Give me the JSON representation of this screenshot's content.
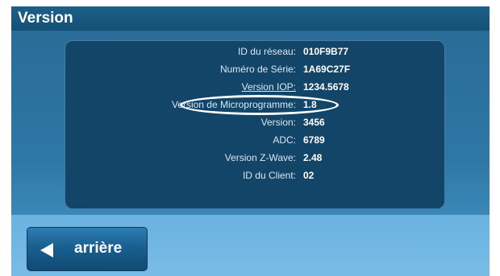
{
  "header": {
    "title": "Version"
  },
  "info": {
    "rows": [
      {
        "label": "ID du réseau:",
        "value": "010F9B77"
      },
      {
        "label": "Numéro de Série:",
        "value": "1A69C27F"
      },
      {
        "label": "Version IOP:",
        "value": "1234.5678"
      },
      {
        "label": "Version de Microprogramme:",
        "value": "1.8"
      },
      {
        "label": "Version:",
        "value": "3456"
      },
      {
        "label": "ADC:",
        "value": "6789"
      },
      {
        "label": "Version Z-Wave:",
        "value": "2.48"
      },
      {
        "label": "ID du Client:",
        "value": "02"
      }
    ]
  },
  "footer": {
    "back_label": "arrière",
    "back_icon": "triangle-left-icon"
  },
  "colors": {
    "title_bar": "#145176",
    "panel": "#134568",
    "footer": "#6bb2e0",
    "button": "#1a5f90"
  }
}
